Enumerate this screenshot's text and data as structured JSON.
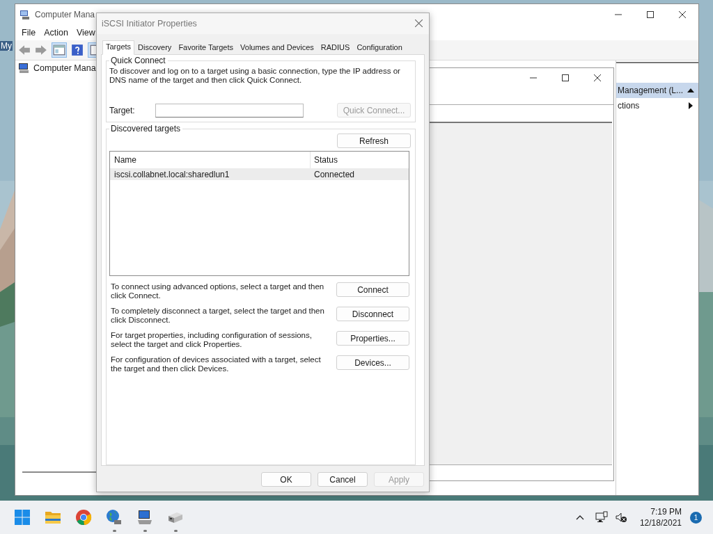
{
  "desktop": {
    "icon_label": "My"
  },
  "back_window": {
    "title": "Computer Mana",
    "menu": [
      "File",
      "Action",
      "View"
    ],
    "tree": [
      "Computer Mana"
    ],
    "actions": {
      "header": "Management (L...",
      "items": [
        "ctions"
      ]
    }
  },
  "dialog": {
    "title": "iSCSI Initiator Properties",
    "tabs": [
      {
        "label": "Targets",
        "selected": true
      },
      {
        "label": "Discovery",
        "selected": false
      },
      {
        "label": "Favorite Targets",
        "selected": false
      },
      {
        "label": "Volumes and Devices",
        "selected": false
      },
      {
        "label": "RADIUS",
        "selected": false
      },
      {
        "label": "Configuration",
        "selected": false
      }
    ],
    "quick_connect": {
      "legend": "Quick Connect",
      "text": "To discover and log on to a target using a basic connection, type the IP address or DNS name of the target and then click Quick Connect.",
      "target_label": "Target:",
      "button": {
        "label": "Quick Connect...",
        "disabled": true
      }
    },
    "discovered": {
      "legend": "Discovered targets",
      "refresh": "Refresh",
      "columns": [
        "Name",
        "Status"
      ],
      "rows": [
        {
          "name": "iscsi.collabnet.local:sharedlun1",
          "status": "Connected",
          "selected": true
        }
      ],
      "actions": [
        {
          "text": "To connect using advanced options, select a target and then click Connect.",
          "button": "Connect"
        },
        {
          "text": "To completely disconnect a target, select the target and then click Disconnect.",
          "button": "Disconnect"
        },
        {
          "text": "For target properties, including configuration of sessions, select the target and click Properties.",
          "button": "Properties..."
        },
        {
          "text": "For configuration of devices associated with a target, select the target and then click Devices.",
          "button": "Devices..."
        }
      ]
    },
    "buttons": [
      {
        "label": "OK",
        "disabled": false
      },
      {
        "label": "Cancel",
        "disabled": false
      },
      {
        "label": "Apply",
        "disabled": true
      }
    ]
  },
  "taskbar": {
    "apps": [
      {
        "kind": "start",
        "running": false
      },
      {
        "kind": "folder",
        "running": false
      },
      {
        "kind": "browser",
        "running": false
      },
      {
        "kind": "globe",
        "running": true
      },
      {
        "kind": "computer",
        "running": true
      },
      {
        "kind": "drive",
        "running": true
      }
    ],
    "time": "7:19 PM",
    "date": "12/18/2021",
    "badge": "1"
  }
}
